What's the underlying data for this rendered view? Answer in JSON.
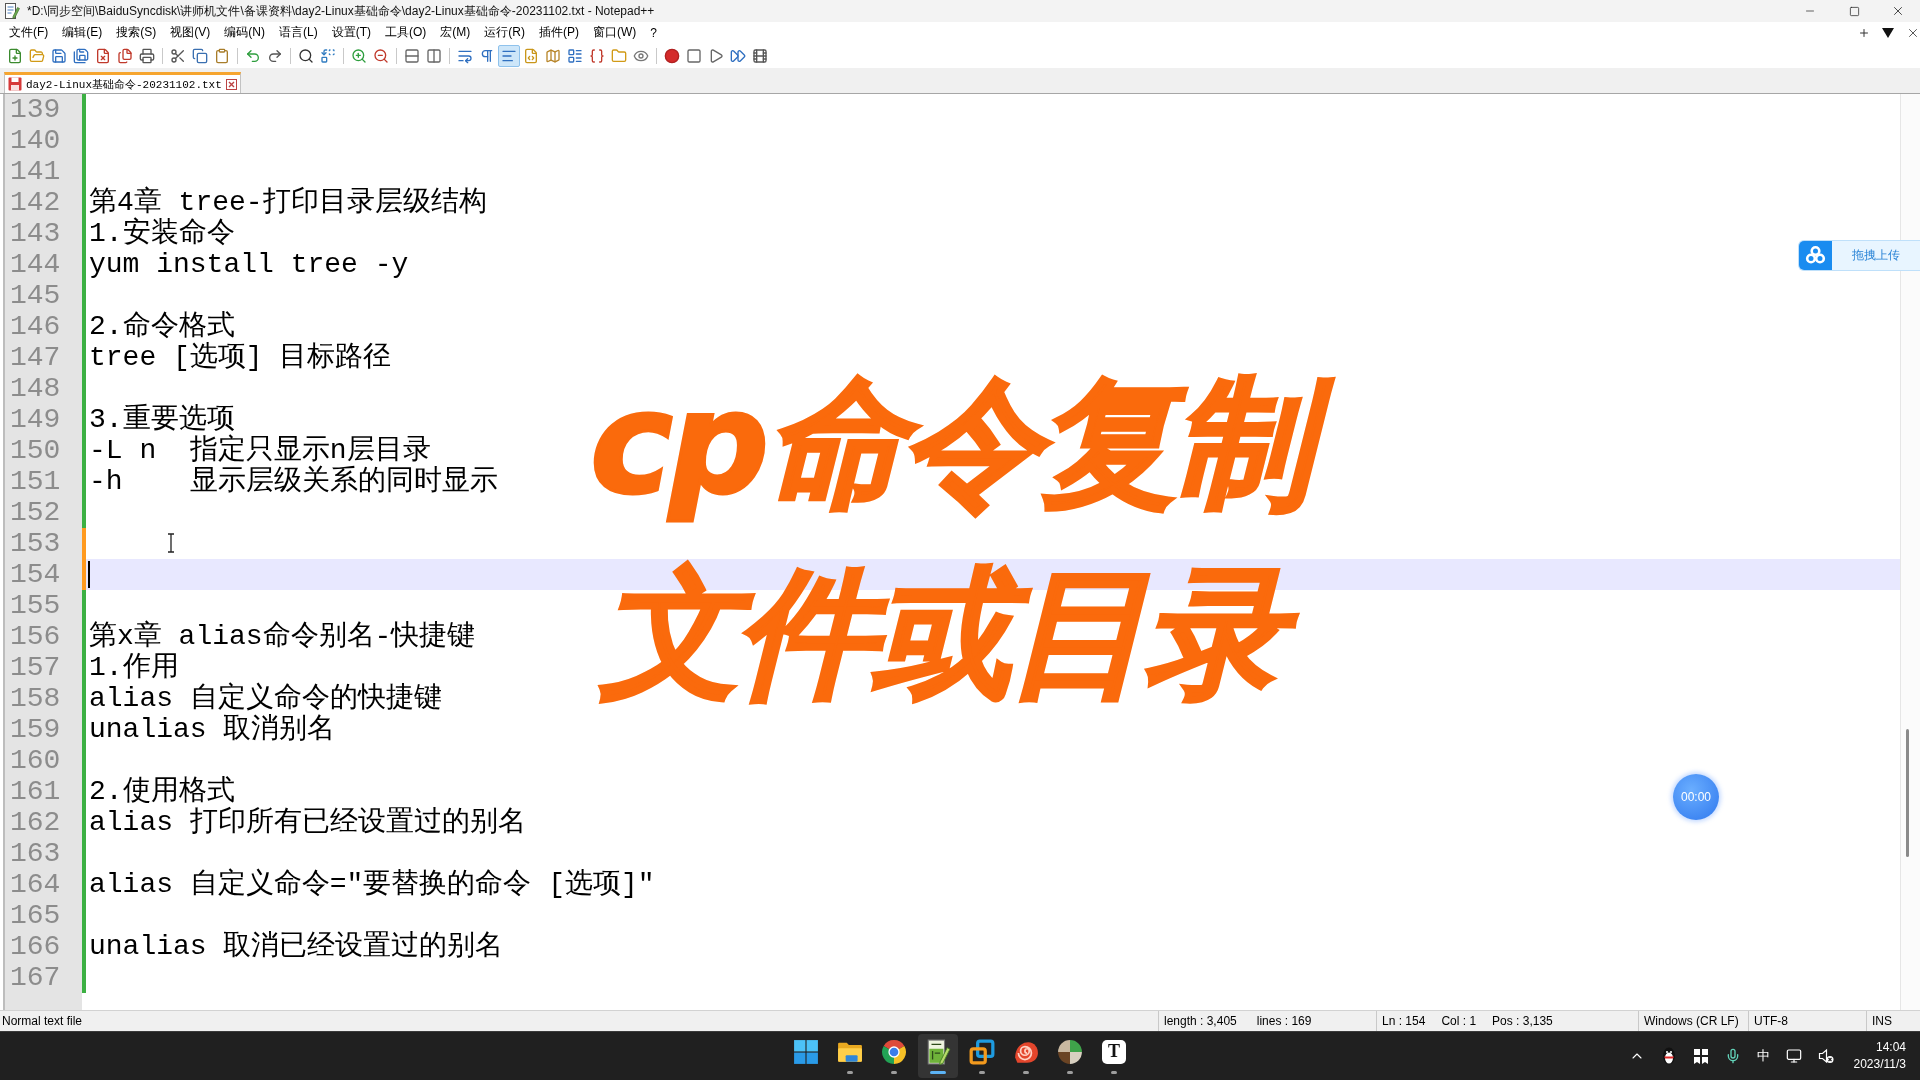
{
  "window": {
    "title": "*D:\\同步空间\\BaiduSyncdisk\\讲师机文件\\备课资料\\day2-Linux基础命令\\day2-Linux基础命令-20231102.txt - Notepad++"
  },
  "menu": [
    "文件(F)",
    "编辑(E)",
    "搜索(S)",
    "视图(V)",
    "编码(N)",
    "语言(L)",
    "设置(T)",
    "工具(O)",
    "宏(M)",
    "运行(R)",
    "插件(P)",
    "窗口(W)",
    "?"
  ],
  "toolbar": {
    "groups": [
      [
        {
          "pressed": false
        },
        {
          "pressed": false
        },
        {
          "pressed": false
        },
        {
          "pressed": false
        },
        {
          "pressed": false
        },
        {
          "pressed": false
        },
        {
          "pressed": false
        }
      ],
      [
        {
          "pressed": false
        },
        {
          "pressed": false
        },
        {
          "pressed": false
        }
      ],
      [
        {
          "pressed": false
        },
        {
          "pressed": false
        }
      ],
      [
        {
          "pressed": false
        },
        {
          "pressed": false
        }
      ],
      [
        {
          "pressed": false
        },
        {
          "pressed": false
        }
      ],
      [
        {
          "pressed": false
        },
        {
          "pressed": false
        }
      ],
      [
        {
          "pressed": false
        },
        {
          "pressed": false
        },
        {
          "pressed": true
        },
        {
          "pressed": false
        },
        {
          "pressed": false
        },
        {
          "pressed": false
        },
        {
          "pressed": false
        },
        {
          "pressed": false
        },
        {
          "pressed": false
        }
      ],
      [
        {
          "pressed": false
        },
        {
          "pressed": false
        },
        {
          "pressed": false
        },
        {
          "pressed": false
        },
        {
          "pressed": false
        }
      ]
    ]
  },
  "tabs": [
    {
      "label": "day2-Linux基础命令-20231102.txt",
      "selected": true,
      "modified": true
    }
  ],
  "editor": {
    "lines": [
      {
        "number": "139",
        "modified": false,
        "current": false
      },
      {
        "number": "140",
        "modified": false,
        "current": false
      },
      {
        "number": "141",
        "modified": false,
        "current": false
      },
      {
        "number": "142",
        "text": "第4章 tree-打印目录层级结构",
        "modified": false,
        "current": false
      },
      {
        "number": "143",
        "text": "1.安装命令",
        "modified": false,
        "current": false
      },
      {
        "number": "144",
        "text": "yum install tree -y",
        "modified": false,
        "current": false
      },
      {
        "number": "145",
        "modified": false,
        "current": false
      },
      {
        "number": "146",
        "text": "2.命令格式",
        "modified": false,
        "current": false
      },
      {
        "number": "147",
        "text": "tree [选项] 目标路径",
        "modified": false,
        "current": false
      },
      {
        "number": "148",
        "modified": false,
        "current": false
      },
      {
        "number": "149",
        "text": "3.重要选项",
        "modified": false,
        "current": false
      },
      {
        "number": "150",
        "text": "-L n  指定只显示n层目录",
        "modified": false,
        "current": false
      },
      {
        "number": "151",
        "text": "-h    显示层级关系的同时显示",
        "modified": false,
        "current": false
      },
      {
        "number": "152",
        "modified": false,
        "current": false
      },
      {
        "number": "153",
        "modified": true,
        "current": false
      },
      {
        "number": "154",
        "modified": true,
        "current": true
      },
      {
        "number": "155",
        "modified": false,
        "current": false
      },
      {
        "number": "156",
        "text": "第x章 alias命令别名-快捷键",
        "modified": false,
        "current": false
      },
      {
        "number": "157",
        "text": "1.作用",
        "modified": false,
        "current": false
      },
      {
        "number": "158",
        "text": "alias 自定义命令的快捷键",
        "modified": false,
        "current": false
      },
      {
        "number": "159",
        "text": "unalias 取消别名",
        "modified": false,
        "current": false
      },
      {
        "number": "160",
        "modified": false,
        "current": false
      },
      {
        "number": "161",
        "text": "2.使用格式",
        "modified": false,
        "current": false
      },
      {
        "number": "162",
        "text": "alias 打印所有已经设置过的别名",
        "modified": false,
        "current": false
      },
      {
        "number": "163",
        "modified": false,
        "current": false
      },
      {
        "number": "164",
        "text": "alias 自定义命令=\"要替换的命令 [选项]\"",
        "modified": false,
        "current": false
      },
      {
        "number": "165",
        "modified": false,
        "current": false
      },
      {
        "number": "166",
        "text": "unalias 取消已经设置过的别名",
        "modified": false,
        "current": false
      },
      {
        "number": "167",
        "modified": false,
        "current": false
      }
    ]
  },
  "overlay_title": {
    "lines": [
      "cp命令复制",
      "文件或目录"
    ]
  },
  "upload_widget": {
    "label": "拖拽上传"
  },
  "timer": {
    "time": "00:00"
  },
  "status_bar": {
    "doc_type": "Normal text file",
    "length": "length : 3,405",
    "lines": "lines : 169",
    "ln": "Ln : 154",
    "col": "Col : 1",
    "pos": "Pos : 3,135",
    "eol": "Windows (CR LF)",
    "encoding": "UTF-8",
    "mode": "INS"
  },
  "taskbar": {
    "apps": [
      {
        "running": false,
        "selected": false
      },
      {
        "running": true,
        "selected": false
      },
      {
        "running": true,
        "selected": false
      },
      {
        "running": true,
        "selected": true
      },
      {
        "running": true,
        "selected": false
      },
      {
        "running": true,
        "selected": false
      },
      {
        "running": true,
        "selected": false
      },
      {
        "label": "T",
        "running": true,
        "selected": false
      }
    ],
    "ime": "中",
    "clock": {
      "time": "14:04",
      "date": "2023/11/3"
    }
  }
}
